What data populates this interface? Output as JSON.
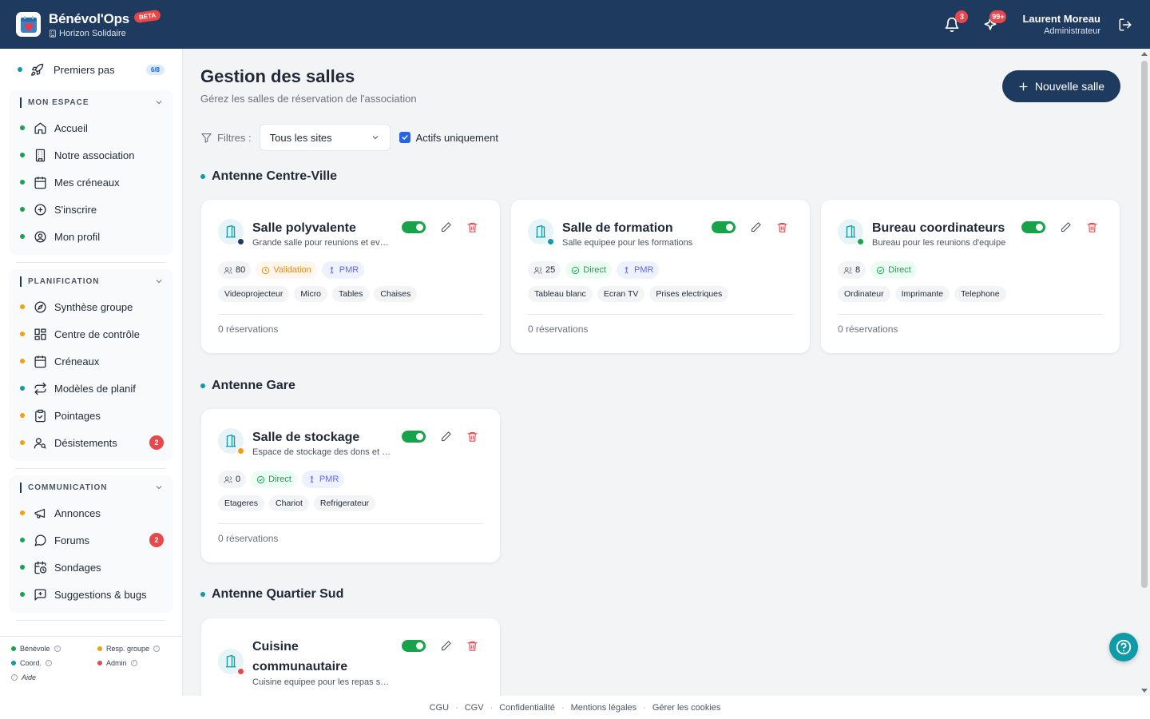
{
  "header": {
    "app_name": "Bénévol'Ops",
    "beta": "BETA",
    "org": "Horizon Solidaire",
    "notif_count": "3",
    "activity_count": "99+",
    "user_name": "Laurent Moreau",
    "user_role": "Administrateur"
  },
  "sidebar": {
    "first_steps": {
      "label": "Premiers pas",
      "progress": "6/8"
    },
    "sections": [
      {
        "title": "MON ESPACE",
        "items": [
          {
            "label": "Accueil",
            "icon": "home-icon"
          },
          {
            "label": "Notre association",
            "icon": "building-icon"
          },
          {
            "label": "Mes créneaux",
            "icon": "calendar-icon"
          },
          {
            "label": "S'inscrire",
            "icon": "plus-circle-icon"
          },
          {
            "label": "Mon profil",
            "icon": "user-circle-icon"
          }
        ]
      },
      {
        "title": "PLANIFICATION",
        "items": [
          {
            "label": "Synthèse groupe",
            "icon": "compass-icon"
          },
          {
            "label": "Centre de contrôle",
            "icon": "grid-icon"
          },
          {
            "label": "Créneaux",
            "icon": "calendar-icon"
          },
          {
            "label": "Modèles de planif",
            "icon": "repeat-icon"
          },
          {
            "label": "Pointages",
            "icon": "clipboard-check-icon"
          },
          {
            "label": "Désistements",
            "icon": "user-search-icon",
            "badge": "2"
          }
        ]
      },
      {
        "title": "COMMUNICATION",
        "items": [
          {
            "label": "Annonces",
            "icon": "megaphone-icon"
          },
          {
            "label": "Forums",
            "icon": "chat-icon",
            "badge": "2"
          },
          {
            "label": "Sondages",
            "icon": "calendar-clock-icon"
          },
          {
            "label": "Suggestions & bugs",
            "icon": "message-plus-icon"
          }
        ]
      }
    ],
    "legend": {
      "benevole": "Bénévole",
      "resp": "Resp. groupe",
      "coord": "Coord.",
      "admin": "Admin",
      "aide": "Aide"
    }
  },
  "main": {
    "title": "Gestion des salles",
    "subtitle": "Gérez les salles de réservation de l'association",
    "new_button": "Nouvelle salle",
    "filters_label": "Filtres :",
    "site_select": "Tous les sites",
    "active_only": "Actifs uniquement",
    "sites": [
      {
        "name": "Antenne Centre-Ville",
        "rooms": [
          {
            "name": "Salle polyvalente",
            "desc": "Grande salle pour reunions et evenements",
            "capacity": "80",
            "mode": "Validation",
            "pmr": "PMR",
            "equipment": [
              "Videoprojecteur",
              "Micro",
              "Tables",
              "Chaises"
            ],
            "reservations": "0 réservations"
          },
          {
            "name": "Salle de formation",
            "desc": "Salle equipee pour les formations",
            "capacity": "25",
            "mode": "Direct",
            "pmr": "PMR",
            "equipment": [
              "Tableau blanc",
              "Ecran TV",
              "Prises electriques"
            ],
            "reservations": "0 réservations"
          },
          {
            "name": "Bureau coordinateurs",
            "desc": "Bureau pour les reunions d'equipe",
            "capacity": "8",
            "mode": "Direct",
            "pmr": "",
            "equipment": [
              "Ordinateur",
              "Imprimante",
              "Telephone"
            ],
            "reservations": "0 réservations"
          }
        ]
      },
      {
        "name": "Antenne Gare",
        "rooms": [
          {
            "name": "Salle de stockage",
            "desc": "Espace de stockage des dons et materiel",
            "capacity": "0",
            "mode": "Direct",
            "pmr": "PMR",
            "equipment": [
              "Etageres",
              "Chariot",
              "Refrigerateur"
            ],
            "reservations": "0 réservations"
          }
        ]
      },
      {
        "name": "Antenne Quartier Sud",
        "rooms": [
          {
            "name": "Cuisine communautaire",
            "desc": "Cuisine equipee pour les repas solidaires",
            "capacity": "",
            "mode": "",
            "pmr": "",
            "equipment": [],
            "reservations": ""
          }
        ]
      }
    ]
  },
  "footer": {
    "links": [
      "CGU",
      "CGV",
      "Confidentialité",
      "Mentions légales",
      "Gérer les cookies"
    ]
  },
  "colors": {
    "primary": "#1e3a5f",
    "teal": "#0e9aa7",
    "green": "#16a34a",
    "orange": "#f59e0b",
    "red": "#e5484d"
  }
}
